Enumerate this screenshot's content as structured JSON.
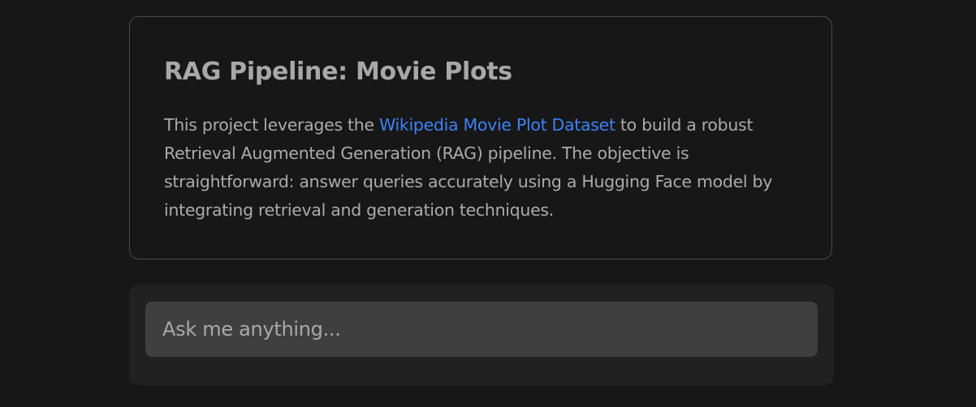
{
  "info_card": {
    "title": "RAG Pipeline: Movie Plots",
    "description_before_link": "This project leverages the ",
    "link_text": "Wikipedia Movie Plot Dataset",
    "description_after_link": " to build a robust Retrieval Augmented Generation (RAG) pipeline. The objective is straightforward: answer queries accurately using a Hugging Face model by integrating retrieval and generation techniques."
  },
  "chat": {
    "input_value": "",
    "input_placeholder": "Ask me anything..."
  },
  "colors": {
    "background": "#171717",
    "link": "#3b82f6",
    "input_background": "#3f3f3f",
    "panel_background": "#212121"
  }
}
